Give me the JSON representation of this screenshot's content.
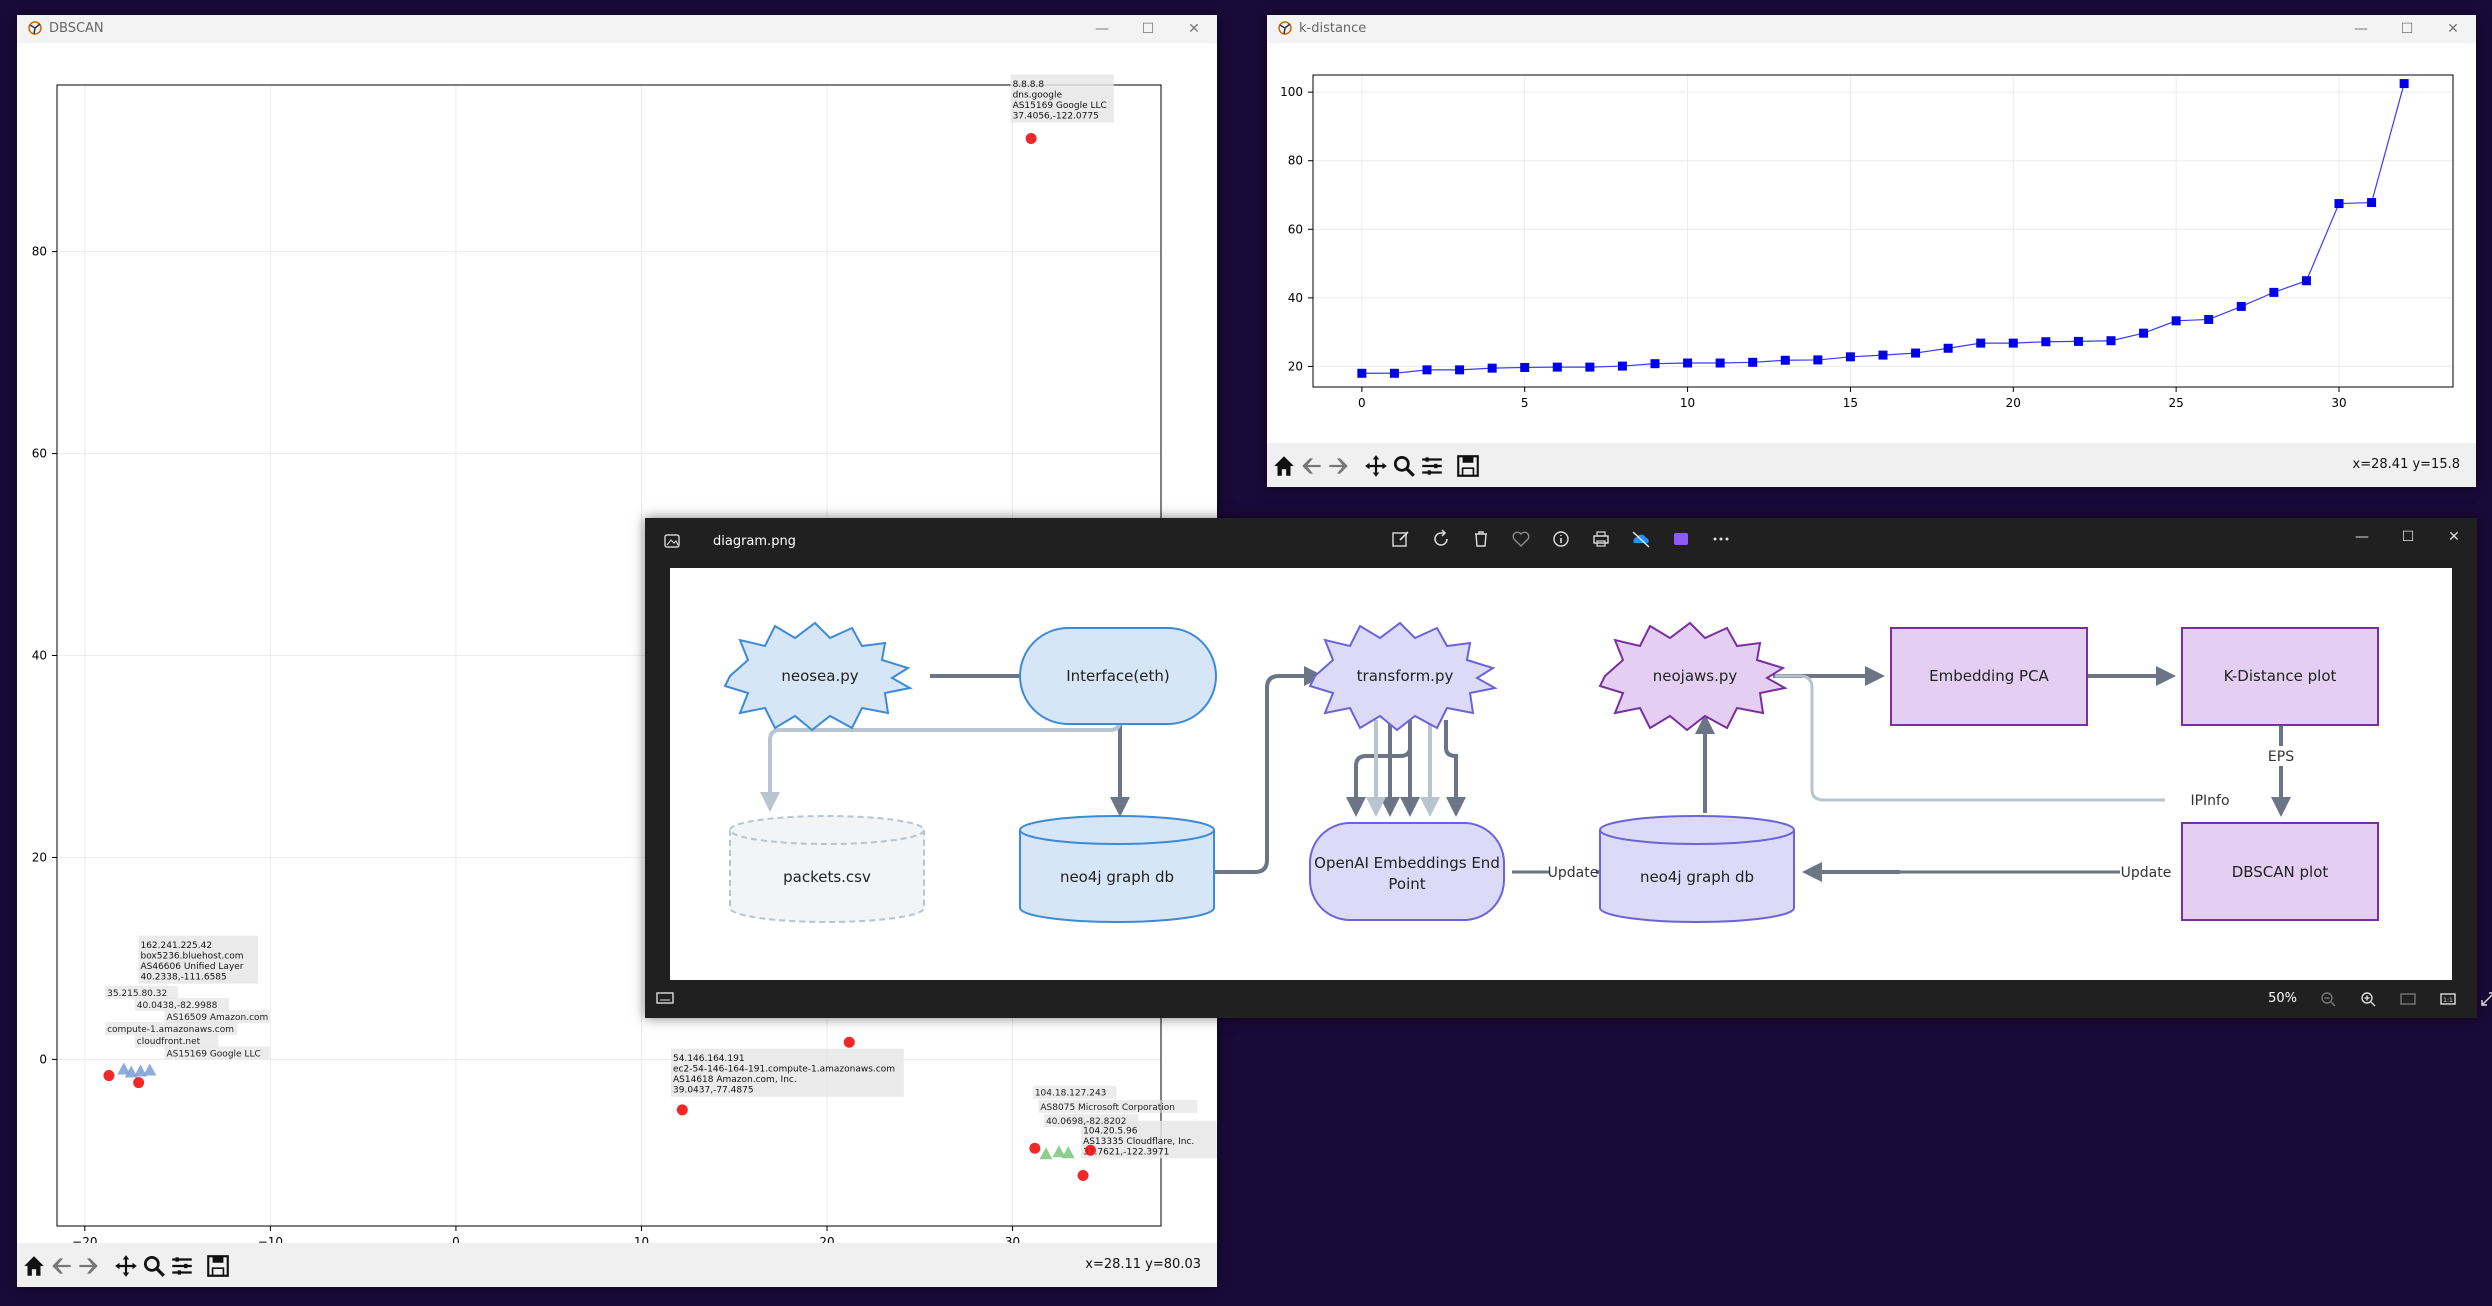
{
  "dbscan_window": {
    "title": "DBSCAN",
    "coords": "x=28.11 y=80.03",
    "x_ticks": [
      "−20",
      "−10",
      "0",
      "10",
      "20",
      "30"
    ],
    "y_ticks": [
      "0",
      "20",
      "40",
      "60",
      "80"
    ]
  },
  "kdist_window": {
    "title": "k-distance",
    "coords": "x=28.41 y=15.8",
    "x_ticks": [
      "0",
      "5",
      "10",
      "15",
      "20",
      "25",
      "30"
    ],
    "y_ticks": [
      "20",
      "40",
      "60",
      "80",
      "100"
    ]
  },
  "photo_window": {
    "filename": "diagram.png",
    "zoom": "50%"
  },
  "diagram": {
    "nodes": {
      "neosea": "neosea.py",
      "interface": "Interface(eth)",
      "transform": "transform.py",
      "neojaws": "neojaws.py",
      "pca": "Embedding PCA",
      "kdistance": "K-Distance plot",
      "packets": "packets.csv",
      "neo4j_1": "neo4j graph db",
      "openai_line1": "OpenAI Embeddings End",
      "openai_line2": "Point",
      "neo4j_2": "neo4j graph db",
      "dbscan": "DBSCAN plot"
    },
    "edge_labels": {
      "eps": "EPS",
      "ipinfo": "IPInfo",
      "update_left": "Update",
      "update_right": "Update"
    }
  },
  "dbscan_annotations": [
    {
      "lines": [
        "8.8.8.8",
        "dns.google",
        "AS15169 Google LLC",
        "37.4056,-122.0775"
      ]
    },
    {
      "lines": [
        "162.241.225.42",
        "box5236.bluehost.com",
        "AS46606 Unified Layer",
        "40.2338,-111.6585"
      ]
    },
    {
      "lines": [
        "54.146.164.191",
        "ec2-54-146-164-191.compute-1.amazonaws.com",
        "AS14618 Amazon.com, Inc.",
        "39.0437,-77.4875"
      ]
    },
    {
      "lines": [
        "104.20.5.96",
        "AS13335 Cloudflare, Inc.",
        "37.7621,-122.3971"
      ]
    }
  ],
  "dbscan_cluster_labels": [
    "35.215.80.32",
    "40.0438,-82.9988",
    "AS16509 Amazon.com",
    "compute-1.amazonaws.com",
    "cloudfront.net",
    "AS15169 Google LLC"
  ],
  "dbscan_right_cluster_labels": [
    "104.18.127.243",
    "AS8075 Microsoft Corporation",
    "40.0698,-82.8202"
  ],
  "chart_data": [
    {
      "type": "line",
      "title": "",
      "xlabel": "",
      "ylabel": "",
      "xlim": [
        -1.5,
        33.5
      ],
      "ylim": [
        14,
        105
      ],
      "grid": true,
      "series": [
        {
          "values": [
            18,
            18,
            19,
            19,
            19.5,
            19.7,
            19.8,
            19.8,
            20.1,
            20.8,
            21,
            21,
            21.2,
            21.8,
            21.9,
            22.8,
            23.3,
            23.9,
            25.3,
            26.8,
            26.8,
            27.2,
            27.3,
            27.5,
            29.7,
            33.3,
            33.7,
            37.5,
            41.6,
            45,
            67.5,
            67.8,
            102.5
          ]
        }
      ]
    },
    {
      "type": "scatter",
      "title": "",
      "xlabel": "",
      "ylabel": "",
      "xlim": [
        -21.5,
        38
      ],
      "ylim": [
        -16.5,
        96.5
      ],
      "grid": true,
      "points": [
        {
          "x": 31.0,
          "y": 91.2,
          "cluster": "noise",
          "marker": "circle"
        },
        {
          "x": -18.7,
          "y": -1.6,
          "cluster": "noise",
          "marker": "circle"
        },
        {
          "x": -17.1,
          "y": -2.3,
          "cluster": "noise",
          "marker": "circle"
        },
        {
          "x": -17.9,
          "y": -1.0,
          "cluster": "a",
          "marker": "triangle"
        },
        {
          "x": -17.5,
          "y": -1.3,
          "cluster": "a",
          "marker": "triangle"
        },
        {
          "x": -17.0,
          "y": -1.2,
          "cluster": "b",
          "marker": "triangle"
        },
        {
          "x": -16.5,
          "y": -1.1,
          "cluster": "b",
          "marker": "triangle"
        },
        {
          "x": 12.2,
          "y": -5.0,
          "cluster": "noise",
          "marker": "circle"
        },
        {
          "x": 21.2,
          "y": 1.7,
          "cluster": "noise",
          "marker": "circle"
        },
        {
          "x": 31.2,
          "y": -8.8,
          "cluster": "noise",
          "marker": "circle"
        },
        {
          "x": 33.8,
          "y": -11.5,
          "cluster": "noise",
          "marker": "circle"
        },
        {
          "x": 31.8,
          "y": -9.4,
          "cluster": "c",
          "marker": "triangle"
        },
        {
          "x": 32.5,
          "y": -9.2,
          "cluster": "c",
          "marker": "triangle"
        },
        {
          "x": 33.0,
          "y": -9.3,
          "cluster": "c",
          "marker": "triangle"
        },
        {
          "x": 34.2,
          "y": -9.0,
          "cluster": "noise",
          "marker": "circle"
        }
      ]
    }
  ]
}
